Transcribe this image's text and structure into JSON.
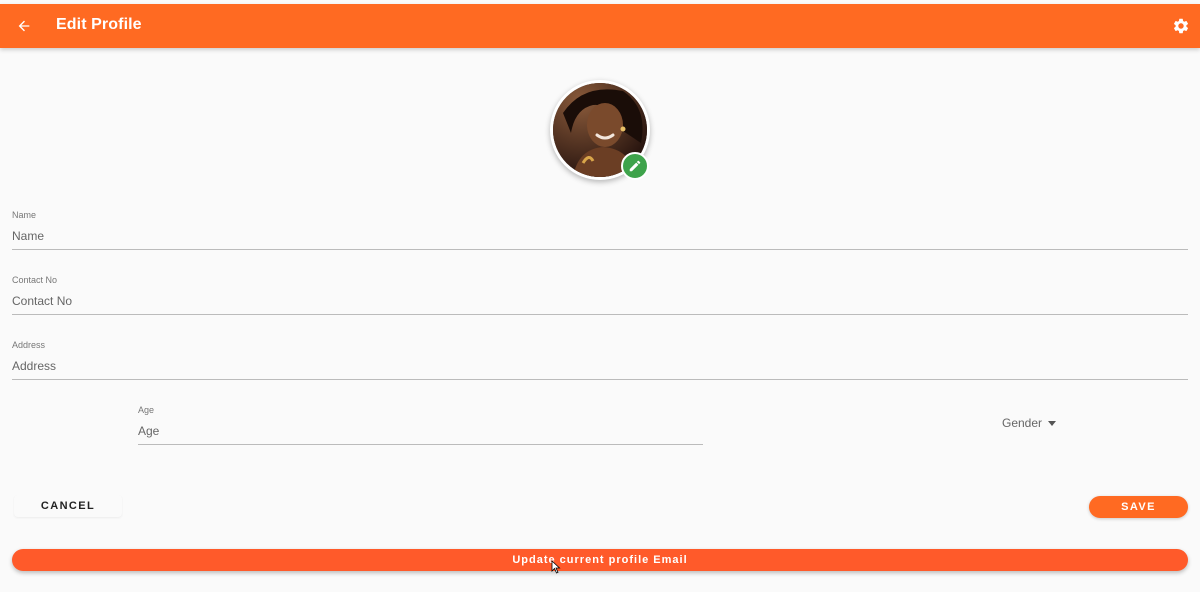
{
  "app_bar": {
    "title": "Edit Profile",
    "back_icon": "arrow-left-icon",
    "settings_icon": "gear-icon",
    "color": "#ff6a22"
  },
  "avatar": {
    "edit_icon": "pencil-icon",
    "badge_color": "#3ea34b"
  },
  "form": {
    "name": {
      "label": "Name",
      "placeholder": "Name",
      "value": ""
    },
    "contact": {
      "label": "Contact No",
      "placeholder": "Contact No",
      "value": ""
    },
    "address": {
      "label": "Address",
      "placeholder": "Address",
      "value": ""
    },
    "age": {
      "label": "Age",
      "placeholder": "Age",
      "value": ""
    },
    "gender": {
      "label": "Gender",
      "icon": "caret-down-icon"
    }
  },
  "actions": {
    "cancel_label": "CANCEL",
    "save_label": "SAVE",
    "update_email_label": "Update current profile Email",
    "accent": "#ff5a2a"
  }
}
